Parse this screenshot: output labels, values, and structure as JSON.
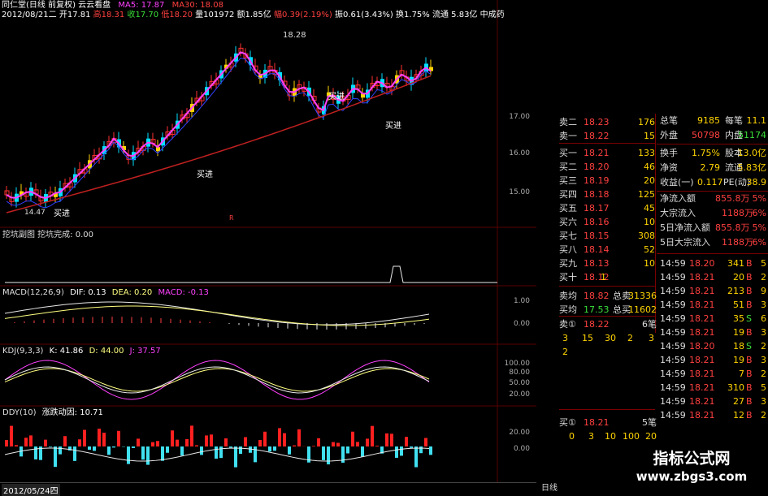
{
  "header": {
    "line1": "同仁堂(日线 前复权) 云云看盘",
    "ma5": "MA5: 17.87",
    "ma30": "MA30: 18.08",
    "line2_date": "2012/08/21二",
    "open": "开17.81",
    "high": "高18.31",
    "close": "收17.70",
    "low": "低18.20",
    "vol": "量101972",
    "amount": "额1.85亿",
    "change_pct": "幅0.39(2.19%)",
    "amp": "振0.61(3.43%)",
    "turnover": "换1.75%",
    "float": "流通 5.83亿",
    "industry": "中成药"
  },
  "main_chart": {
    "price_ticks": [
      "17.00",
      "16.00",
      "15.00"
    ],
    "annotations": [
      "买进",
      "买进",
      "买进",
      "买进"
    ],
    "peak_label": "18.28",
    "low_label": "14.47",
    "marker_r": "R"
  },
  "panels": {
    "wakeng": "挖坑副图  挖坑完成: 0.00",
    "macd_name": "MACD(12,26,9)",
    "macd_dif": "DIF: 0.13",
    "macd_dea": "DEA: 0.20",
    "macd_val": "MACD: -0.13",
    "kdj_name": "KDJ(9,3,3)",
    "kdj_k": "K: 41.86",
    "kdj_d": "D: 44.00",
    "kdj_j": "J: 37.57",
    "ddy_name": "DDY(10)",
    "ddy_val": "涨跌动因: 10.71",
    "macd_ticks": [
      "1.00",
      "0.00"
    ],
    "kdj_ticks": [
      "100.00",
      "80.00",
      "50.00",
      "20.00"
    ],
    "ddy_ticks": [
      "20.00",
      "0.00"
    ]
  },
  "bottom": {
    "date": "2012/05/24四",
    "daily": "日线"
  },
  "order_book": {
    "sells": [
      {
        "label": "卖二",
        "price": "18.23",
        "vol": "176"
      },
      {
        "label": "卖一",
        "price": "18.22",
        "vol": "15"
      }
    ],
    "buys": [
      {
        "label": "买一",
        "price": "18.21",
        "vol": "133"
      },
      {
        "label": "买二",
        "price": "18.20",
        "vol": "46"
      },
      {
        "label": "买三",
        "price": "18.19",
        "vol": "20"
      },
      {
        "label": "买四",
        "price": "18.18",
        "vol": "125"
      },
      {
        "label": "买五",
        "price": "18.17",
        "vol": "45"
      },
      {
        "label": "买六",
        "price": "18.16",
        "vol": "10"
      },
      {
        "label": "买七",
        "price": "18.15",
        "vol": "308"
      },
      {
        "label": "买八",
        "price": "18.14",
        "vol": "52"
      },
      {
        "label": "买九",
        "price": "18.13",
        "vol": "10"
      },
      {
        "label": "买十",
        "price": "18.12",
        "vol": "1"
      }
    ],
    "sell_avg_label": "卖均",
    "sell_avg": "18.82",
    "total_sell_label": "总卖",
    "total_sell": "31336",
    "buy_avg_label": "买均",
    "buy_avg": "17.53",
    "total_buy_label": "总买",
    "total_buy": "11602",
    "sell1_label": "卖①",
    "sell1_price": "18.22",
    "sell1_count": "6笔",
    "sell1_queue": [
      "3",
      "15",
      "30",
      "2",
      "3"
    ],
    "sell1_queue2": [
      "2"
    ],
    "buy1_label": "买①",
    "buy1_price": "18.21",
    "buy1_count": "5笔",
    "buy1_queue": [
      "0",
      "3",
      "10",
      "100",
      "20"
    ]
  },
  "stats": [
    {
      "l1": "总笔",
      "v1": "9185",
      "l2": "每笔",
      "v2": "11.1"
    },
    {
      "l1": "外盘",
      "v1": "50798",
      "l2": "内盘",
      "v2": "51174"
    },
    {
      "l1": "换手",
      "v1": "1.75%",
      "l2": "股本",
      "v2": "13.0亿"
    },
    {
      "l1": "净资",
      "v1": "2.79",
      "l2": "流通",
      "v2": "5.83亿"
    },
    {
      "l1": "收益(一)",
      "v1": "0.117",
      "l2": "PE(动)",
      "v2": "38.9"
    }
  ],
  "flows": [
    {
      "label": "净流入额",
      "value": "855.8万",
      "pct": "5%"
    },
    {
      "label": "大宗流入",
      "value": "1188万",
      "pct": "6%"
    },
    {
      "label": "5日净流入额",
      "value": "855.8万",
      "pct": "5%"
    },
    {
      "label": "5日大宗流入",
      "value": "1188万",
      "pct": "6%"
    }
  ],
  "ticks": [
    {
      "time": "14:59",
      "price": "18.20",
      "vol": "341",
      "side": "B",
      "n": "5"
    },
    {
      "time": "14:59",
      "price": "18.21",
      "vol": "20",
      "side": "B",
      "n": "2"
    },
    {
      "time": "14:59",
      "price": "18.21",
      "vol": "213",
      "side": "B",
      "n": "9"
    },
    {
      "time": "14:59",
      "price": "18.21",
      "vol": "51",
      "side": "B",
      "n": "3"
    },
    {
      "time": "14:59",
      "price": "18.21",
      "vol": "35",
      "side": "S",
      "n": "6"
    },
    {
      "time": "14:59",
      "price": "18.21",
      "vol": "19",
      "side": "B",
      "n": "3"
    },
    {
      "time": "14:59",
      "price": "18.20",
      "vol": "18",
      "side": "S",
      "n": "2"
    },
    {
      "time": "14:59",
      "price": "18.21",
      "vol": "19",
      "side": "B",
      "n": "3"
    },
    {
      "time": "14:59",
      "price": "18.21",
      "vol": "7",
      "side": "B",
      "n": "2"
    },
    {
      "time": "14:59",
      "price": "18.21",
      "vol": "310",
      "side": "B",
      "n": "5"
    },
    {
      "time": "14:59",
      "price": "18.21",
      "vol": "27",
      "side": "B",
      "n": "3"
    },
    {
      "time": "14:59",
      "price": "18.21",
      "vol": "12",
      "side": "B",
      "n": "2"
    }
  ],
  "watermark": {
    "title": "指标公式网",
    "url": "www.zbgs3.com"
  }
}
